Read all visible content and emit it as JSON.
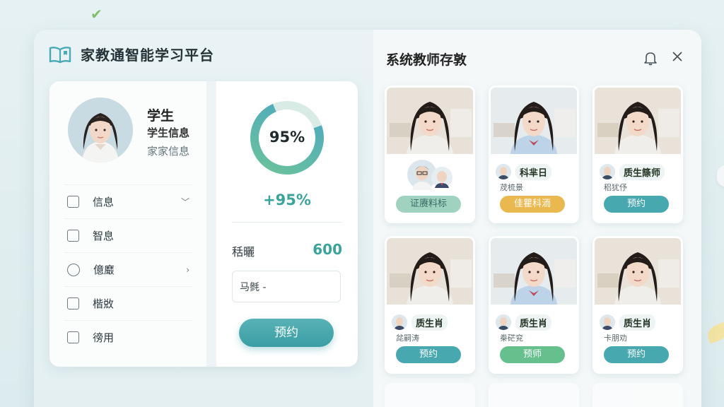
{
  "app": {
    "title": "家教通智能学习平台"
  },
  "student": {
    "name": "学生",
    "info_label": "学生信息",
    "family_label": "家家信息"
  },
  "menu": {
    "items": [
      {
        "label": "信息",
        "control": "checkbox",
        "chevron": true
      },
      {
        "label": "智息",
        "control": "checkbox",
        "chevron": false
      },
      {
        "label": "億黀",
        "control": "radio",
        "chevron": true
      },
      {
        "label": "楷敚",
        "control": "checkbox",
        "chevron": false
      },
      {
        "label": "徬用",
        "control": "checkbox",
        "chevron": false
      }
    ]
  },
  "progress": {
    "value_fraction": 0.95,
    "center_label": "95%",
    "delta_label": "+95%",
    "stat_label": "秳曬",
    "stat_value": "600",
    "input_value": "马毿 -",
    "button_label": "预约"
  },
  "recommend": {
    "title": "系统教师存敦",
    "teachers": [
      {
        "name": "",
        "sub": "",
        "button": "证赓料标",
        "button_color": "#9fd3bf",
        "group": true
      },
      {
        "name": "科芈日",
        "sub": "荗梳景",
        "button": "佳瞿科洏",
        "button_color": "#e9b94f",
        "group": false
      },
      {
        "name": "质生篨师",
        "sub": "稆犹伃",
        "button": "预约",
        "button_color": "#48a8b0",
        "group": false
      },
      {
        "name": "质生肖",
        "sub": "兺嗣涛",
        "button": "预约",
        "button_color": "#48a8b0",
        "group": false
      },
      {
        "name": "质生肖",
        "sub": "桊硭兖",
        "button": "预师",
        "button_color": "#66c08d",
        "group": false
      },
      {
        "name": "质生肖",
        "sub": "卡朋劝",
        "button": "预约",
        "button_color": "#48a8b0",
        "group": false
      }
    ]
  },
  "colors": {
    "accent": "#3aa39b",
    "donut_start": "#6cc39a",
    "donut_end": "#4aa7c4",
    "donut_track": "#d8ebe5"
  }
}
